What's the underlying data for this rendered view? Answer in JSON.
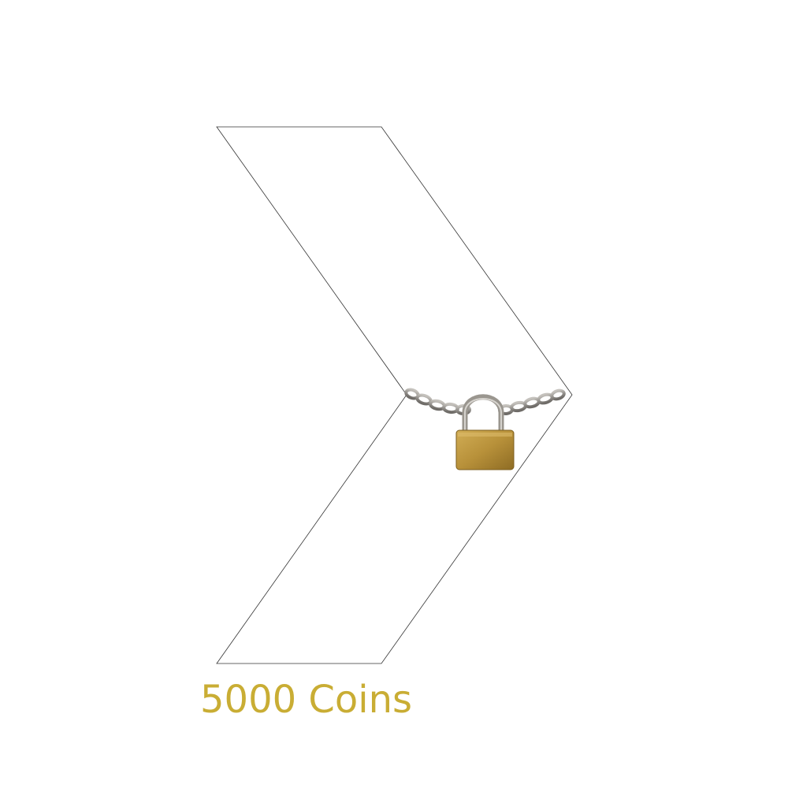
{
  "next_button": {
    "icon": "chevron-right-icon",
    "state": "locked",
    "lock_icon": "padlock-chain-icon"
  },
  "unlock": {
    "price_text": "5000 Coins",
    "price_color": "#c9ad34"
  },
  "colors": {
    "background": "#ffffff",
    "outline": "#333333",
    "chain": "#8f8c88",
    "padlock_body": "#b8913a",
    "padlock_shackle": "#9a968f"
  }
}
